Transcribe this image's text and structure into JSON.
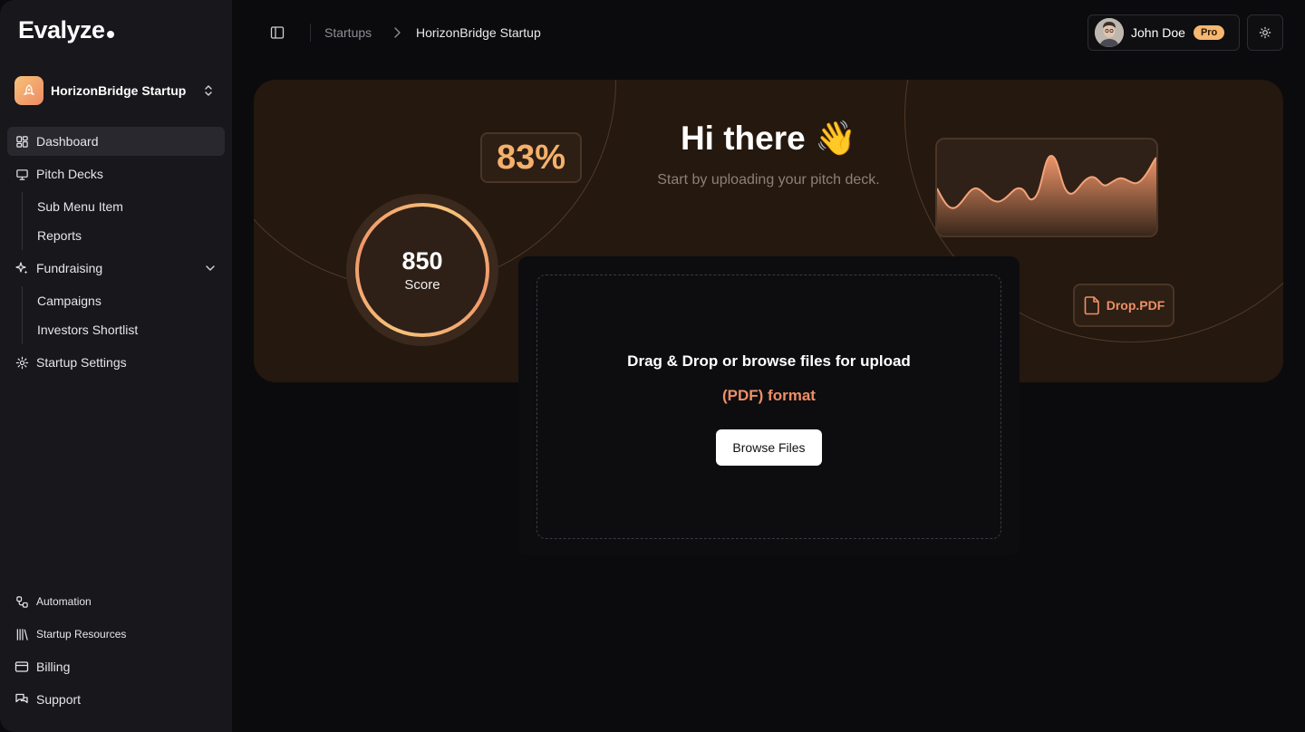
{
  "app": {
    "logo": "Evalyze"
  },
  "workspace": {
    "name": "HorizonBridge Startup"
  },
  "sidebar": {
    "dashboard": "Dashboard",
    "pitch_decks": "Pitch Decks",
    "pitch_sub": [
      "Sub Menu Item",
      "Reports"
    ],
    "fundraising": "Fundraising",
    "fundraising_sub": [
      "Campaigns",
      "Investors Shortlist"
    ],
    "startup_settings": "Startup Settings",
    "bottom": [
      "Automation",
      "Startup Resources",
      "Billing",
      "Support"
    ]
  },
  "header": {
    "breadcrumb": [
      "Startups",
      "HorizonBridge Startup"
    ],
    "user_name": "John Doe",
    "badge": "Pro"
  },
  "hero": {
    "greeting": "Hi there 👋",
    "subtitle": "Start by uploading your pitch deck.",
    "percent": "83%",
    "score_value": "850",
    "score_label": "Score",
    "drop_pdf": "Drop.PDF"
  },
  "upload": {
    "title": "Drag & Drop or browse files for upload",
    "format": "(PDF) format",
    "button": "Browse Files"
  },
  "colors": {
    "accent": "#f4b06c",
    "accent2": "#ef8f66",
    "pro_badge": "#f6b76f"
  }
}
